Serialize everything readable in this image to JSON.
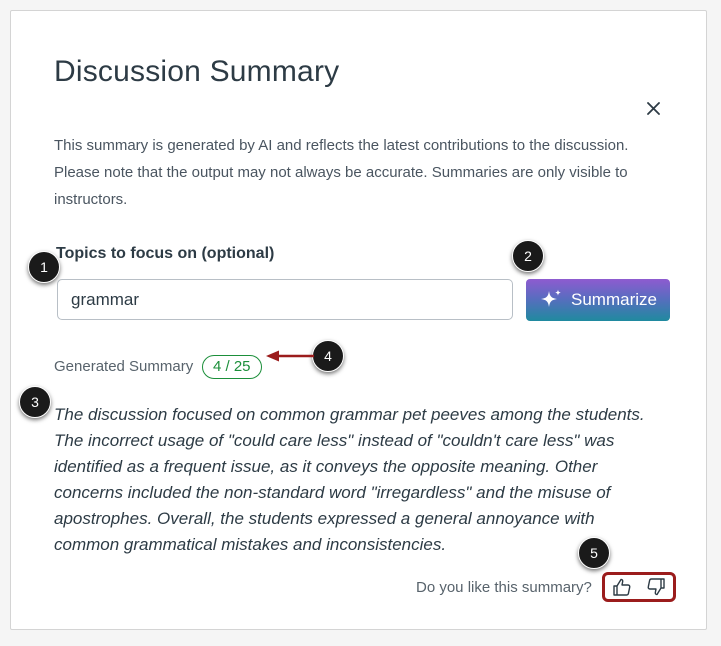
{
  "dialog": {
    "title": "Discussion Summary",
    "description": "This summary is generated by AI and reflects the latest contributions to the discussion. Please note that the output may not always be accurate. Summaries are only visible to instructors.",
    "close_icon": "close-icon"
  },
  "topics": {
    "label": "Topics to focus on (optional)",
    "value": "grammar"
  },
  "summarize_button": {
    "label": "Summarize",
    "icon": "sparkle-icon"
  },
  "generated": {
    "label": "Generated Summary",
    "count": "4 / 25",
    "text": "The discussion focused on common grammar pet peeves among the students. The incorrect usage of \"could care less\" instead of \"couldn't care less\" was identified as a frequent issue, as it conveys the opposite meaning. Other concerns included the non-standard word \"irregardless\" and the misuse of apostrophes. Overall, the students expressed a general annoyance with common grammatical mistakes and inconsistencies."
  },
  "feedback": {
    "question": "Do you like this summary?",
    "like_icon": "thumbs-up-icon",
    "dislike_icon": "thumbs-down-icon"
  },
  "callouts": [
    "1",
    "2",
    "3",
    "4",
    "5"
  ],
  "colors": {
    "badge_green": "#1b8f3a",
    "annotation_red": "#9b1c1c",
    "button_gradient_top": "#8e5bd0",
    "button_gradient_bottom": "#1f8a9f"
  }
}
